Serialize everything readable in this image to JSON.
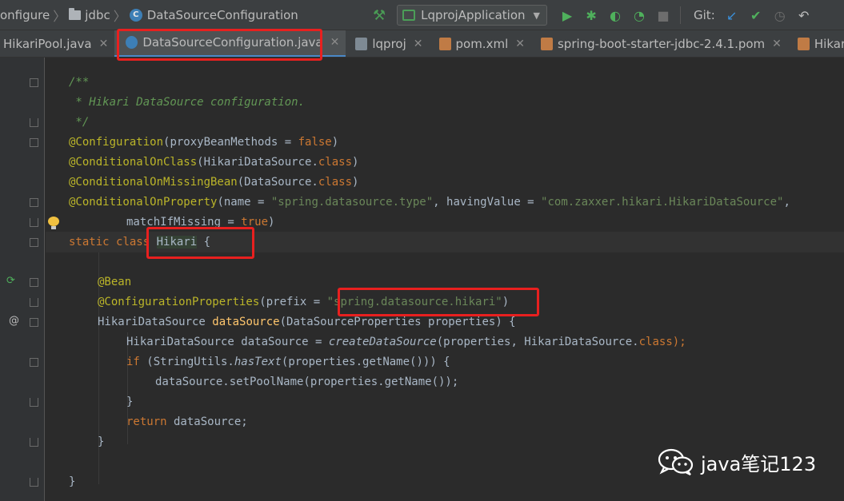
{
  "breadcrumb": {
    "items": [
      "onfigure",
      "jdbc",
      "DataSourceConfiguration"
    ]
  },
  "toolbar": {
    "run_config": "LqprojApplication",
    "git_label": "Git:"
  },
  "tabs": [
    {
      "label": "HikariPool.java",
      "icon": "java-class-icon",
      "active": false
    },
    {
      "label": "DataSourceConfiguration.java",
      "icon": "java-class-icon",
      "active": true
    },
    {
      "label": "lqproj",
      "icon": "module-icon",
      "active": false
    },
    {
      "label": "pom.xml",
      "icon": "xml-file-icon",
      "active": false
    },
    {
      "label": "spring-boot-starter-jdbc-2.4.1.pom",
      "icon": "xml-file-icon",
      "active": false
    },
    {
      "label": "HikariC",
      "icon": "xml-file-icon",
      "active": false
    }
  ],
  "code": {
    "doc_open": "/**",
    "doc_text": " * Hikari DataSource configuration.",
    "doc_close": " */",
    "ann_configuration": "@Configuration",
    "proxy_param": "(proxyBeanMethods = ",
    "false_kw": "false",
    "close_paren": ")",
    "ann_on_class": "@ConditionalOnClass",
    "on_class_arg": "(HikariDataSource.",
    "class_kw": "class",
    "ann_on_missing": "@ConditionalOnMissingBean",
    "on_missing_arg": "(DataSource.",
    "ann_on_property": "@ConditionalOnProperty",
    "name_eq": "(name = ",
    "type_str": "\"spring.datasource.type\"",
    "having_eq": ", havingValue = ",
    "hikari_class_str": "\"com.zaxxer.hikari.HikariDataSource\"",
    "trailing_comma": ",",
    "match_if_missing": "matchIfMissing = ",
    "true_kw": "true",
    "static_kw": "static",
    "class_kw2": "class",
    "class_name": "Hikari",
    "open_brace": " {",
    "ann_bean": "@Bean",
    "ann_config_props": "@ConfigurationProperties",
    "prefix_eq": "(prefix = ",
    "prefix_str": "\"spring.datasource.hikari\"",
    "ret_type": "HikariDataSource ",
    "method_name": "dataSource",
    "method_params": "(DataSourceProperties properties) {",
    "local_decl": "HikariDataSource dataSource = ",
    "create_call": "createDataSource",
    "create_args": "(properties, HikariDataSource.",
    "semi_close": ");",
    "if_kw": "if",
    "if_open": " (StringUtils.",
    "has_text": "hasText",
    "if_rest": "(properties.getName())) {",
    "set_pool": "dataSource.setPoolName(properties.getName());",
    "close_brace": "}",
    "return_kw": "return",
    "return_rest": " dataSource;"
  },
  "watermark": {
    "text": "java笔记123"
  }
}
